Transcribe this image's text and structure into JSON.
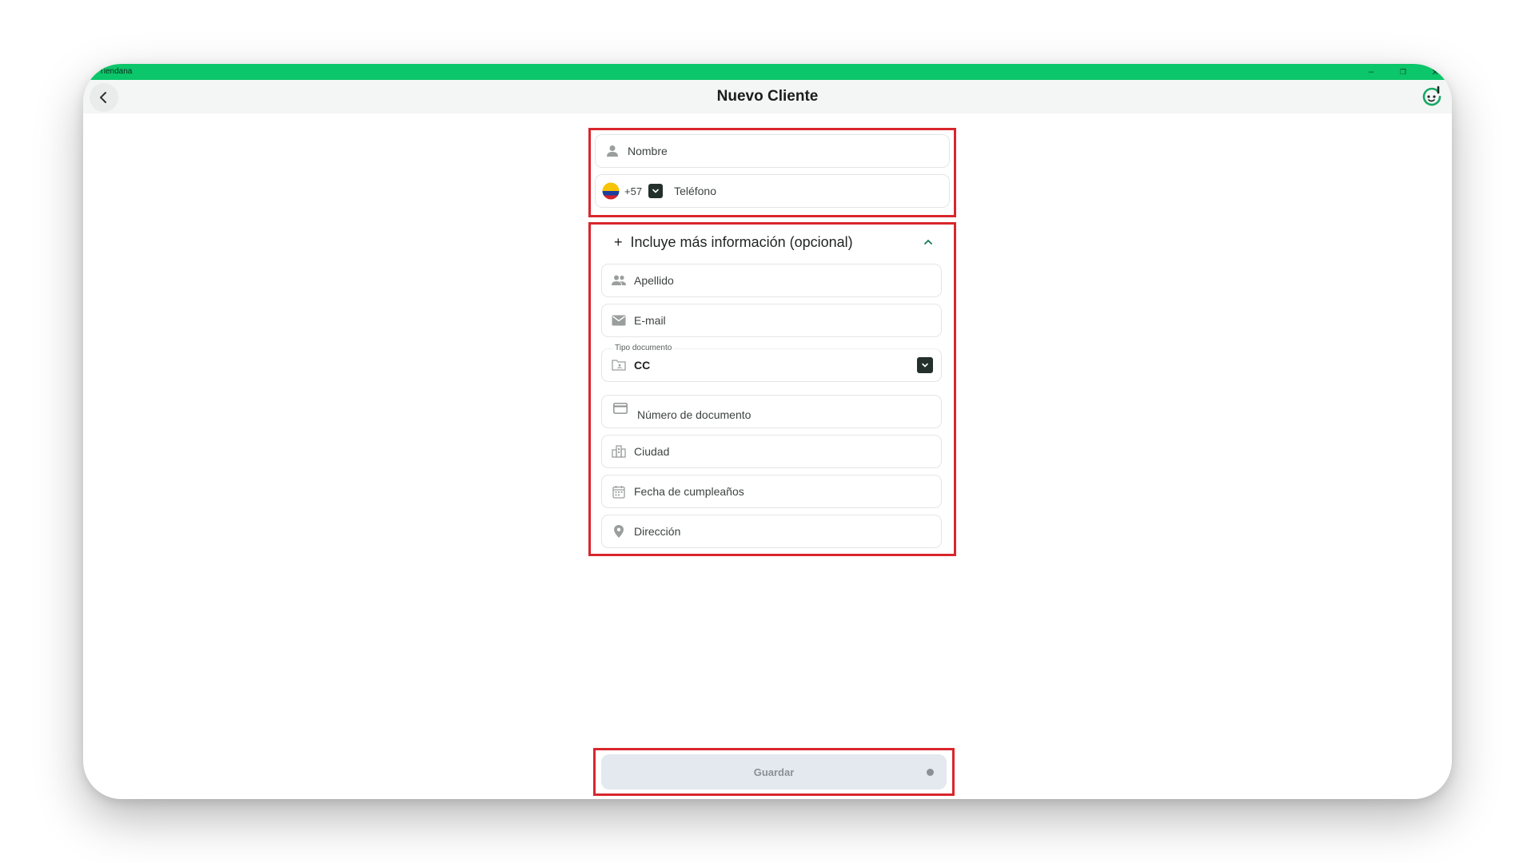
{
  "window": {
    "app_name": "Tiendana",
    "controls": {
      "minimize": "–",
      "maximize": "❐",
      "close": "✕"
    }
  },
  "header": {
    "title": "Nuevo Cliente"
  },
  "form": {
    "nombre_placeholder": "Nombre",
    "phone_code": "+57",
    "telefono_placeholder": "Teléfono",
    "more_info": {
      "plus": "+",
      "label": "Incluye más información (opcional)"
    },
    "apellido_placeholder": "Apellido",
    "email_placeholder": "E-mail",
    "tipo_documento": {
      "label": "Tipo documento",
      "value": "CC"
    },
    "numero_documento_placeholder": "Número de documento",
    "ciudad_placeholder": "Ciudad",
    "fecha_placeholder": "Fecha de cumpleaños",
    "direccion_placeholder": "Dirección"
  },
  "actions": {
    "save_label": "Guardar"
  },
  "colors": {
    "brand_green": "#0bc66a",
    "highlight_red": "#d9262c",
    "dropdown_dark": "#23302b",
    "save_disabled_bg": "#e4e8ef"
  },
  "icons": [
    "back-arrow-icon",
    "avatar-logo-icon",
    "person-icon",
    "colombia-flag-icon",
    "chevron-down-icon",
    "plus-icon",
    "chevron-up-icon",
    "people-icon",
    "mail-icon",
    "id-folder-icon",
    "card-icon",
    "city-icon",
    "calendar-icon",
    "location-pin-icon"
  ]
}
